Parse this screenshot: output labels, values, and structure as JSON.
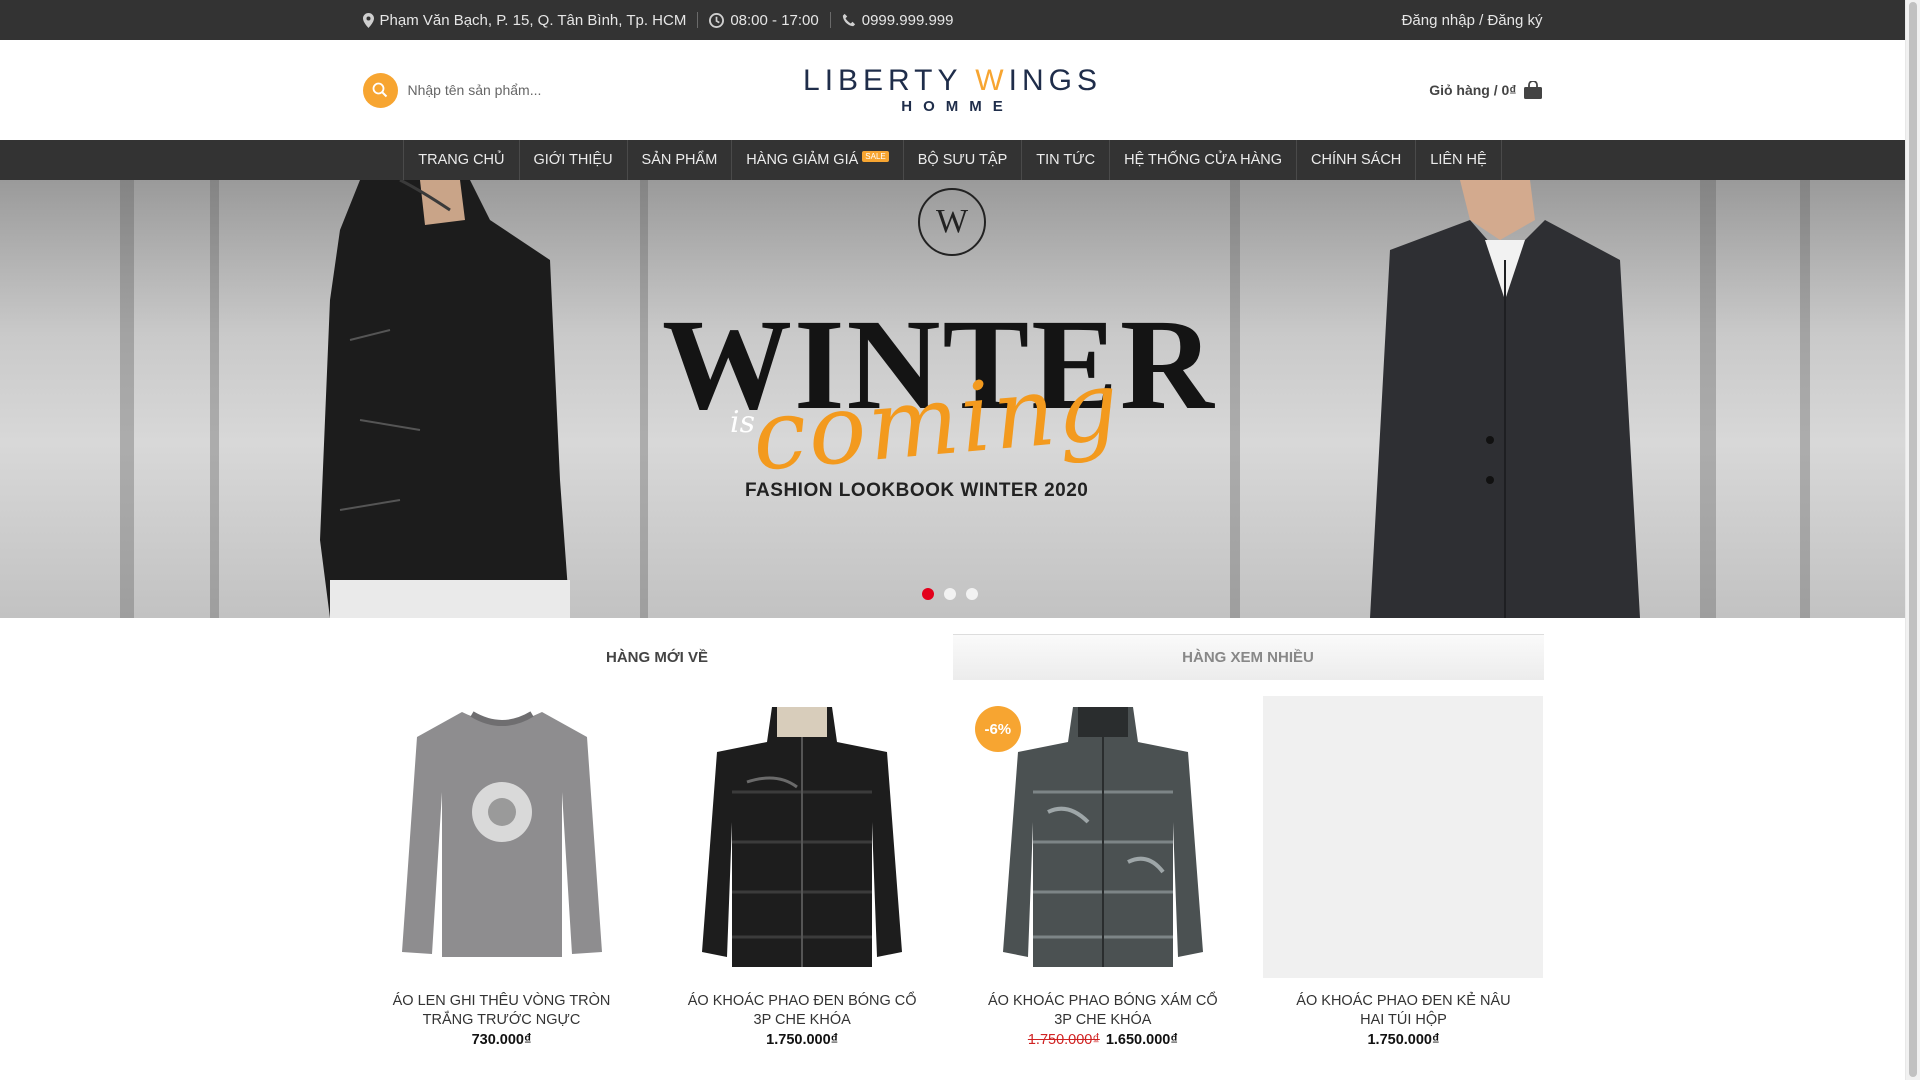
{
  "topbar": {
    "address": "Phạm Văn Bạch, P. 15, Q. Tân Bình, Tp. HCM",
    "hours": "08:00 - 17:00",
    "phone": "0999.999.999",
    "account": "Đăng nhập / Đăng ký"
  },
  "header": {
    "search_placeholder": "Nhập tên sản phẩm...",
    "logo_main_a": "LIBERTY ",
    "logo_main_w": "W",
    "logo_main_b": "INGS",
    "logo_sub": "HOMME",
    "cart_label": "Giỏ hàng / 0₫"
  },
  "nav": {
    "items": [
      "TRANG CHỦ",
      "GIỚI THIỆU",
      "SẢN PHẨM",
      "HÀNG GIẢM GIÁ",
      "BỘ SƯU TẬP",
      "TIN TỨC",
      "HỆ THỐNG CỬA HÀNG",
      "CHÍNH SÁCH",
      "LIÊN HỆ"
    ],
    "sale_badge": "SALE"
  },
  "banner": {
    "emblem": "W",
    "headline": "WINTER",
    "is": "is",
    "script": "coming",
    "subline": "FASHION LOOKBOOK WINTER 2020",
    "active_slide": 1,
    "slide_count": 3
  },
  "tabs": [
    "HÀNG MỚI VỀ",
    "HÀNG XEM NHIỀU"
  ],
  "products": [
    {
      "name": "ÁO LEN GHI THÊU VÒNG TRÒN TRẮNG TRƯỚC NGỰC",
      "price": "730.000₫",
      "old_price": "",
      "badge": "",
      "image": "grey-sweater"
    },
    {
      "name": "ÁO KHOÁC PHAO ĐEN BÓNG CỔ 3P CHE KHÓA",
      "price": "1.750.000₫",
      "old_price": "",
      "badge": "",
      "image": "black-puffer"
    },
    {
      "name": "ÁO KHOÁC PHAO BÓNG XÁM CỔ 3P CHE KHÓA",
      "price": "1.650.000₫",
      "old_price": "1.750.000₫",
      "badge": "-6%",
      "image": "grey-puffer"
    },
    {
      "name": "ÁO KHOÁC PHAO ĐEN KẺ NÂU HAI TÚI HỘP",
      "price": "1.750.000₫",
      "old_price": "",
      "badge": "",
      "image": "placeholder"
    }
  ],
  "colors": {
    "accent": "#f7a531",
    "dark": "#333333",
    "active_dot": "#e3001b",
    "old_price": "#d02222"
  }
}
